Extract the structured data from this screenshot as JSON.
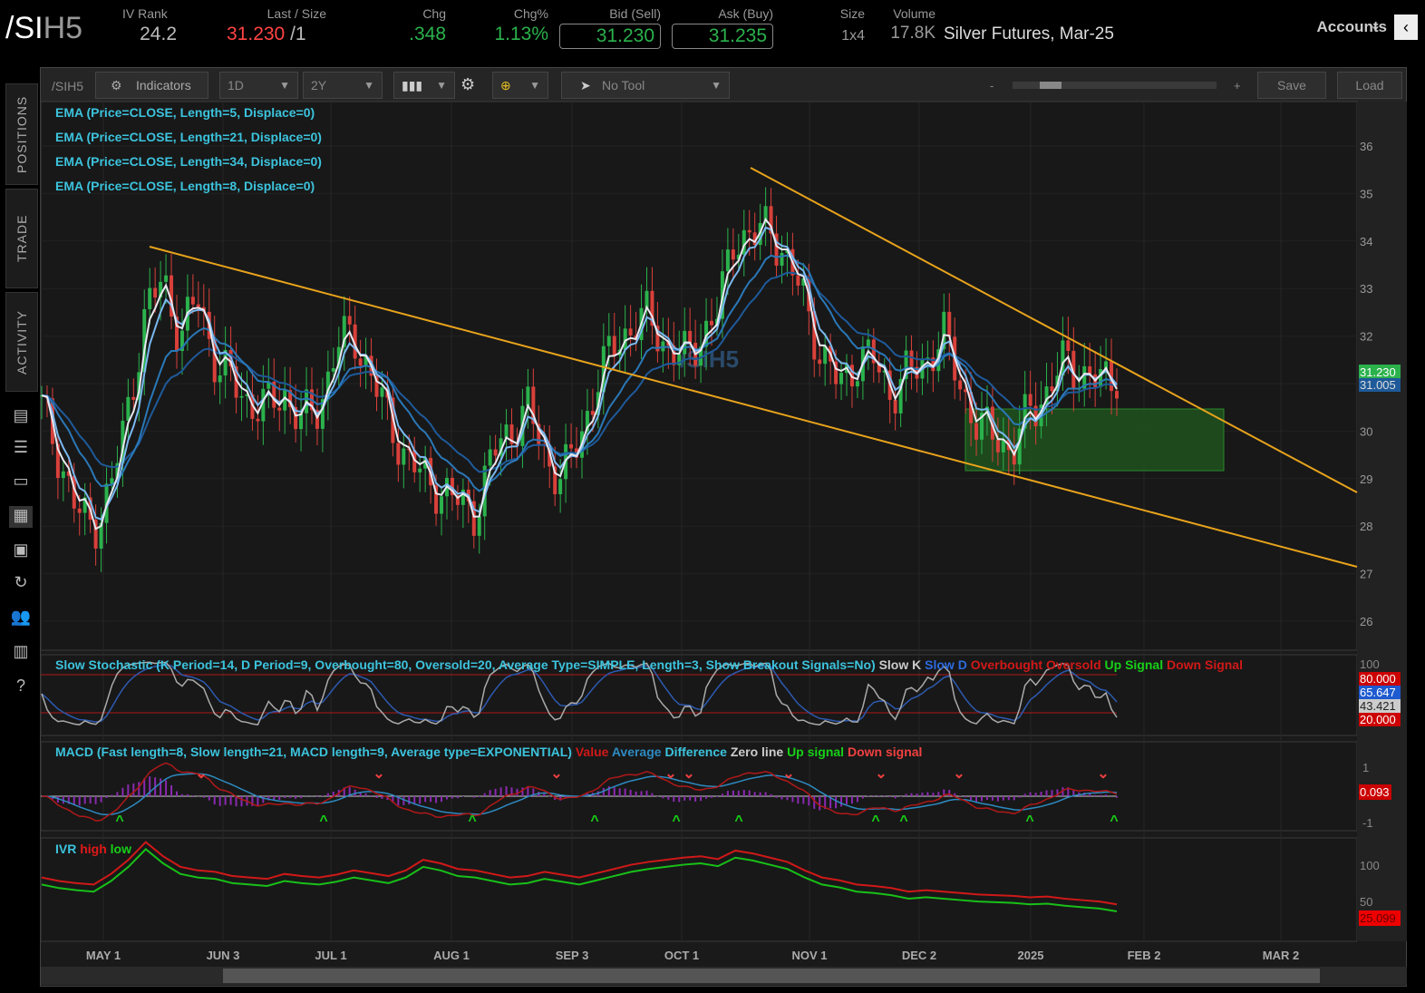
{
  "header": {
    "symbol_main": "/SI",
    "symbol_suffix": "H5",
    "iv_rank_label": "IV Rank",
    "iv_rank": "24.2",
    "last_label": "Last / Size",
    "last": "31.230",
    "size": "/1",
    "chg_label": "Chg",
    "chg": ".348",
    "chgp_label": "Chg%",
    "chgp": "1.13%",
    "bid_label": "Bid (Sell)",
    "bid": "31.230",
    "ask_label": "Ask (Buy)",
    "ask": "31.235",
    "size_label": "Size",
    "size_val": "1x4",
    "volume_label": "Volume",
    "volume": "17.8K",
    "description": "Silver Futures, Mar-25",
    "accounts": "Accounts"
  },
  "sidebar": {
    "tabs": [
      "POSITIONS",
      "TRADE",
      "ACTIVITY"
    ]
  },
  "toolbar": {
    "symbol": "/SIH5",
    "indicators": "Indicators",
    "aggregation": "1D",
    "timeframe": "2Y",
    "tool": "No Tool",
    "zoom_minus": "-",
    "zoom_plus": "+",
    "save": "Save",
    "load": "Load"
  },
  "legend": {
    "ema": [
      "EMA (Price=CLOSE, Length=5, Displace=0)",
      "EMA (Price=CLOSE, Length=21, Displace=0)",
      "EMA (Price=CLOSE, Length=34, Displace=0)",
      "EMA (Price=CLOSE, Length=8, Displace=0)"
    ],
    "watermark": "/SIH5"
  },
  "stoch": {
    "title": "Slow Stochastic (K Period=14, D Period=9, Overbought=80, Oversold=20, Average Type=SIMPLE, Length=3, Show Breakout Signals=No)",
    "items": [
      "Slow K",
      "Slow D",
      "Overbought",
      "Oversold",
      "Up Signal",
      "Down Signal"
    ],
    "axis": [
      "100"
    ],
    "labels": [
      "80.000",
      "65.647",
      "43.421",
      "20.000"
    ]
  },
  "macd": {
    "title": "MACD (Fast length=8, Slow length=21, MACD length=9, Average type=EXPONENTIAL)",
    "items": [
      "Value",
      "Average",
      "Difference",
      "Zero line",
      "Up signal",
      "Down signal"
    ],
    "axis": [
      "1",
      "-1"
    ],
    "label": "0.093"
  },
  "ivr": {
    "title": "IVR",
    "items": [
      "high",
      "low"
    ],
    "axis": [
      "100",
      "50"
    ],
    "label": "25.099"
  },
  "colors": {
    "up": "#2bb24c",
    "down": "#d9403a",
    "trend": "#e8a31c",
    "accent": "#3cc3dd"
  },
  "chart_data": {
    "type": "candlestick",
    "price_axis": [
      "36",
      "35",
      "34",
      "33",
      "32",
      "31",
      "30",
      "29",
      "28",
      "27",
      "26"
    ],
    "price_labels": {
      "last": "31.230",
      "ema": "31.005"
    },
    "date_axis": [
      "MAY 1",
      "JUN 3",
      "JUL 1",
      "AUG 1",
      "SEP 3",
      "OCT 1",
      "NOV 1",
      "DEC 2",
      "2025",
      "FEB 2",
      "MAR 2"
    ],
    "closes": [
      30.5,
      29.5,
      28.3,
      28.0,
      28.8,
      30.5,
      32.5,
      33.2,
      32.0,
      32.8,
      31.5,
      31.0,
      30.6,
      30.5,
      30.8,
      30.2,
      30.5,
      31.8,
      32.0,
      31.2,
      30.2,
      29.5,
      29.0,
      28.8,
      28.5,
      28.3,
      29.5,
      30.0,
      30.5,
      29.5,
      29.0,
      29.8,
      31.0,
      31.8,
      32.2,
      32.4,
      31.8,
      31.5,
      32.0,
      32.5,
      34.2,
      34.0,
      34.4,
      33.5,
      32.8,
      31.5,
      31.0,
      31.5,
      31.5,
      30.8,
      31.2,
      31.5,
      32.0,
      31.0,
      30.0,
      30.0,
      29.5,
      30.5,
      30.8,
      31.5,
      31.2,
      31.0,
      31.23
    ],
    "ivr": [
      70,
      65,
      62,
      60,
      75,
      95,
      120,
      100,
      85,
      80,
      78,
      72,
      70,
      68,
      75,
      72,
      70,
      74,
      80,
      76,
      72,
      80,
      95,
      90,
      82,
      80,
      75,
      70,
      72,
      78,
      74,
      70,
      76,
      82,
      88,
      92,
      95,
      98,
      100,
      96,
      108,
      104,
      98,
      92,
      80,
      70,
      66,
      60,
      58,
      55,
      50,
      52,
      50,
      48,
      46,
      45,
      44,
      42,
      43,
      40,
      38,
      36,
      32
    ]
  }
}
